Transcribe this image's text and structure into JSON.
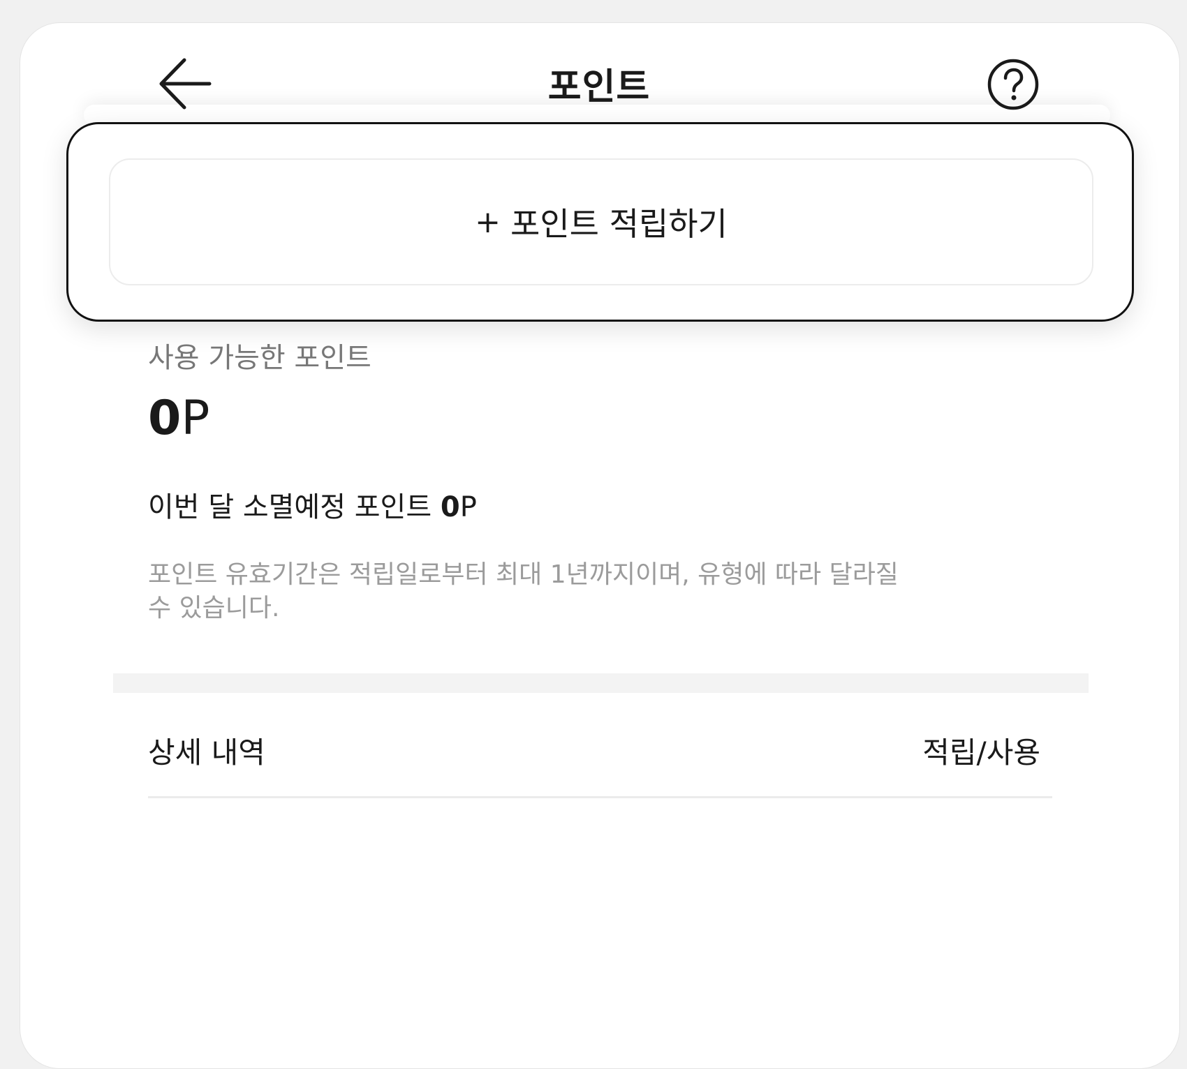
{
  "header": {
    "title": "포인트",
    "back_icon": "arrow-left-icon",
    "help_icon": "question-circle-icon"
  },
  "accrue": {
    "plus": "+",
    "label": "포인트 적립하기"
  },
  "balance": {
    "label": "사용 가능한 포인트",
    "value": "0",
    "unit": "P"
  },
  "expiring": {
    "label": "이번 달 소멸예정 포인트",
    "value": "0",
    "unit": "P"
  },
  "notice": {
    "line1": "포인트 유효기간은 적립일로부터 최대 1년까지이며, 유형에 따라 달라질",
    "line2": "수 있습니다."
  },
  "history": {
    "title": "상세 내역",
    "filter_label": "적립/사용"
  }
}
